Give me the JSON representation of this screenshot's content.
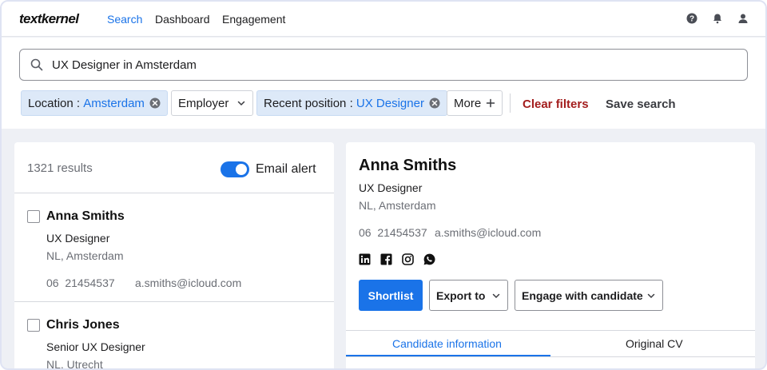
{
  "nav": {
    "logo": "textkernel",
    "links": [
      "Search",
      "Dashboard",
      "Engagement"
    ],
    "active_link": "Search",
    "icons": [
      "help-icon",
      "bell-icon",
      "user-icon"
    ]
  },
  "search": {
    "query": "UX Designer in Amsterdam",
    "icon": "search-icon"
  },
  "filters": {
    "location_label": "Location : ",
    "location_value": "Amsterdam",
    "employer_label": "Employer",
    "recent_position_label": "Recent position : ",
    "recent_position_value": "UX Designer",
    "more_label": "More",
    "clear_label": "Clear filters",
    "save_label": "Save search"
  },
  "results": {
    "count_text": "1321 results",
    "email_alert_label": "Email alert",
    "email_alert_on": true,
    "items": [
      {
        "name": "Anna Smiths",
        "role": "UX Designer",
        "location": "NL, Amsterdam",
        "phone": "06  21454537",
        "email": "a.smiths@icloud.com"
      },
      {
        "name": "Chris Jones",
        "role": "Senior UX Designer",
        "location": "NL, Utrecht"
      }
    ]
  },
  "detail": {
    "name": "Anna Smiths",
    "role": "UX Designer",
    "location": "NL, Amsterdam",
    "phone": "06  21454537",
    "email": "a.smiths@icloud.com",
    "socials": [
      "linkedin-icon",
      "facebook-icon",
      "instagram-icon",
      "whatsapp-icon"
    ],
    "shortlist_label": "Shortlist",
    "export_label": "Export to",
    "engage_label": "Engage with candidate",
    "tabs": [
      "Candidate information",
      "Original CV"
    ],
    "active_tab": "Candidate information"
  },
  "colors": {
    "accent": "#1a73e8",
    "danger": "#a31d1d",
    "chip_bg": "#dde9f8"
  }
}
